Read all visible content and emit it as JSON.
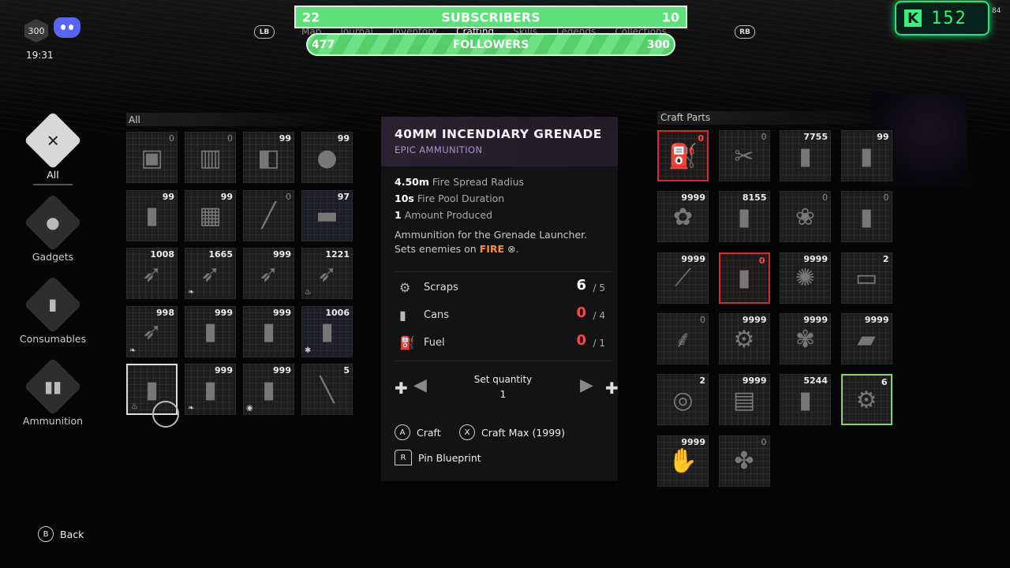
{
  "hud": {
    "level": "300",
    "time": "19:31"
  },
  "stream": {
    "subscribers": {
      "label": "SUBSCRIBERS",
      "left": "22",
      "right": "10"
    },
    "followers": {
      "label": "FOLLOWERS",
      "left": "477",
      "right": "300"
    },
    "kick_count": "152",
    "corner_number": "84"
  },
  "nav": {
    "left_button": "LB",
    "right_button": "RB",
    "tabs": [
      "Map",
      "Journal",
      "Inventory",
      "Crafting",
      "Skills",
      "Legends",
      "Collections"
    ],
    "active_tab_index": 3
  },
  "sidebar": {
    "categories": [
      {
        "label": "All",
        "icon": "wrench-hammer-icon",
        "active": true
      },
      {
        "label": "Gadgets",
        "icon": "grenade-icon",
        "active": false
      },
      {
        "label": "Consumables",
        "icon": "bottle-icon",
        "active": false
      },
      {
        "label": "Ammunition",
        "icon": "bullets-icon",
        "active": false
      }
    ]
  },
  "inventory": {
    "label": "All",
    "items": [
      {
        "count": "0",
        "glyph": "▣"
      },
      {
        "count": "0",
        "glyph": "▥"
      },
      {
        "count": "99",
        "glyph": "◧"
      },
      {
        "count": "99",
        "glyph": "●"
      },
      {
        "count": "99",
        "glyph": "▮"
      },
      {
        "count": "99",
        "glyph": "▦"
      },
      {
        "count": "0",
        "glyph": "╱"
      },
      {
        "count": "97",
        "glyph": "▬"
      },
      {
        "count": "1008",
        "glyph": "➶"
      },
      {
        "count": "1665",
        "glyph": "➶"
      },
      {
        "count": "999",
        "glyph": "➶"
      },
      {
        "count": "1221",
        "glyph": "➶"
      },
      {
        "count": "998",
        "glyph": "➶"
      },
      {
        "count": "999",
        "glyph": "▮"
      },
      {
        "count": "999",
        "glyph": "▮"
      },
      {
        "count": "1006",
        "glyph": "▮"
      },
      {
        "count": "",
        "glyph": "▮"
      },
      {
        "count": "999",
        "glyph": "▮"
      },
      {
        "count": "999",
        "glyph": "▮"
      },
      {
        "count": "5",
        "glyph": "╲"
      }
    ]
  },
  "detail": {
    "title": "40MM INCENDIARY GRENADE",
    "subtitle": "EPIC AMMUNITION",
    "stats": [
      {
        "value": "4.50m",
        "label": "Fire Spread Radius"
      },
      {
        "value": "10s",
        "label": "Fire Pool Duration"
      },
      {
        "value": "1",
        "label": "Amount Produced"
      }
    ],
    "description": "Ammunition for the Grenade Launcher. Sets enemies on",
    "fire_word": "FIRE",
    "requirements": [
      {
        "name": "Scraps",
        "have": "6",
        "need": "/ 5",
        "ok": true
      },
      {
        "name": "Cans",
        "have": "0",
        "need": "/ 4",
        "ok": false
      },
      {
        "name": "Fuel",
        "have": "0",
        "need": "/ 1",
        "ok": false
      }
    ],
    "quantity_label": "Set quantity",
    "quantity_value": "1",
    "craft_button": "A",
    "craft_label": "Craft",
    "craftmax_button": "X",
    "craftmax_label": "Craft Max",
    "craftmax_count": "(1999)",
    "pin_button": "R",
    "pin_label": "Pin Blueprint"
  },
  "craft_parts": {
    "label": "Craft Parts",
    "items": [
      {
        "count": "0",
        "highlight": "red",
        "glyph": "⛽"
      },
      {
        "count": "0",
        "highlight": "",
        "glyph": "✂"
      },
      {
        "count": "7755",
        "highlight": "",
        "glyph": "▮"
      },
      {
        "count": "99",
        "highlight": "",
        "glyph": "▮"
      },
      {
        "count": "9999",
        "highlight": "",
        "glyph": "✿"
      },
      {
        "count": "8155",
        "highlight": "",
        "glyph": "▮"
      },
      {
        "count": "0",
        "highlight": "",
        "glyph": "❀"
      },
      {
        "count": "0",
        "highlight": "",
        "glyph": "▮"
      },
      {
        "count": "9999",
        "highlight": "",
        "glyph": "⟋"
      },
      {
        "count": "0",
        "highlight": "red",
        "glyph": "▮"
      },
      {
        "count": "9999",
        "highlight": "",
        "glyph": "✺"
      },
      {
        "count": "2",
        "highlight": "",
        "glyph": "▭"
      },
      {
        "count": "0",
        "highlight": "",
        "glyph": "⸙"
      },
      {
        "count": "9999",
        "highlight": "",
        "glyph": "⚙"
      },
      {
        "count": "9999",
        "highlight": "",
        "glyph": "✾"
      },
      {
        "count": "9999",
        "highlight": "",
        "glyph": "▰"
      },
      {
        "count": "2",
        "highlight": "",
        "glyph": "◎"
      },
      {
        "count": "9999",
        "highlight": "",
        "glyph": "▤"
      },
      {
        "count": "5244",
        "highlight": "",
        "glyph": "▮"
      },
      {
        "count": "6",
        "highlight": "green",
        "glyph": "⚙"
      },
      {
        "count": "9999",
        "highlight": "",
        "glyph": "✋"
      },
      {
        "count": "0",
        "highlight": "",
        "glyph": "✤"
      }
    ]
  },
  "footer": {
    "back_button": "B",
    "back_label": "Back"
  }
}
